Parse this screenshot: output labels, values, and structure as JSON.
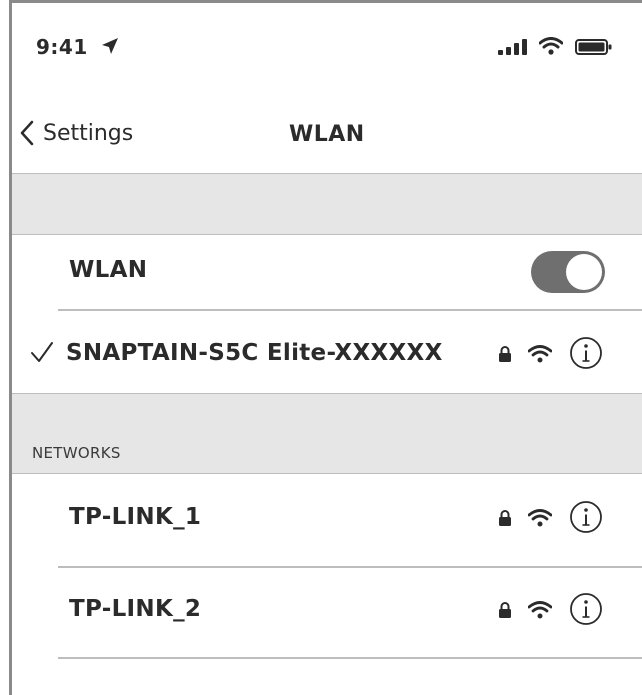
{
  "status_bar": {
    "time": "9:41"
  },
  "nav": {
    "back_label": "Settings",
    "title": "WLAN"
  },
  "wlan_toggle": {
    "label": "WLAN",
    "on": true
  },
  "connected_network": {
    "name": "SNAPTAIN-S5C Elite-XXXXXX",
    "secured": true,
    "selected": true
  },
  "networks_section": {
    "header": "NETWORKS"
  },
  "networks": [
    {
      "name": "TP-LINK_1",
      "secured": true
    },
    {
      "name": "TP-LINK_2",
      "secured": true
    }
  ],
  "icons": [
    "location-arrow-icon",
    "signal-icon",
    "wifi-icon",
    "battery-icon",
    "chevron-left-icon",
    "checkmark-icon",
    "lock-icon",
    "info-icon"
  ],
  "colors": {
    "toggle_on": "#6f6f6f",
    "band_gray": "#e6e6e6",
    "text": "#2b2b2b"
  }
}
